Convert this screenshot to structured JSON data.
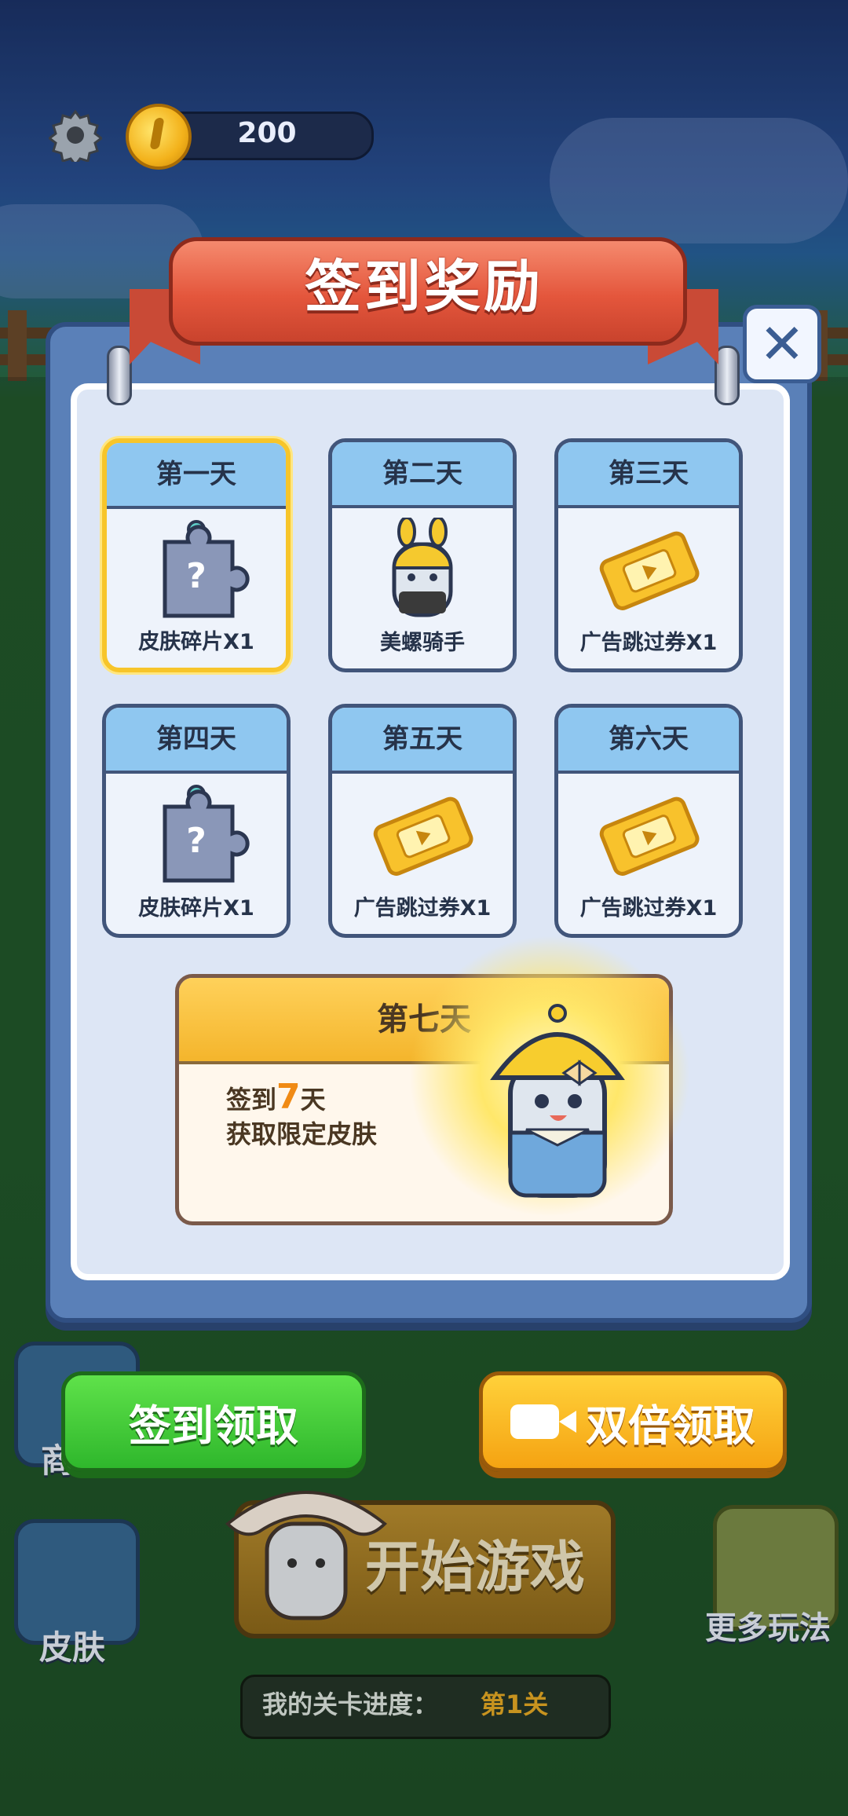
{
  "top_bar": {
    "coins": "200",
    "settings_icon": "gear-icon",
    "coin_icon": "coin-icon"
  },
  "dialog": {
    "title": "签到奖励",
    "close_icon": "close-icon",
    "days": [
      {
        "day": "第一天",
        "reward": "皮肤碎片X1",
        "icon": "puzzle-piece-icon",
        "selected": true
      },
      {
        "day": "第二天",
        "reward": "美螺骑手",
        "icon": "rider-skin-icon",
        "selected": false
      },
      {
        "day": "第三天",
        "reward": "广告跳过券X1",
        "icon": "ticket-icon",
        "selected": false
      },
      {
        "day": "第四天",
        "reward": "皮肤碎片X1",
        "icon": "puzzle-piece-icon",
        "selected": false
      },
      {
        "day": "第五天",
        "reward": "广告跳过券X1",
        "icon": "ticket-icon",
        "selected": false
      },
      {
        "day": "第六天",
        "reward": "广告跳过券X1",
        "icon": "ticket-icon",
        "selected": false
      }
    ],
    "day7": {
      "day": "第七天",
      "line1_prefix": "签到",
      "line1_number": "7",
      "line1_suffix": "天",
      "line2": "获取限定皮肤",
      "icon": "limited-skin-character-icon"
    }
  },
  "buttons": {
    "sign_in": "签到领取",
    "double": "双倍领取",
    "double_icon": "video-camera-icon"
  },
  "lobby": {
    "shop_label": "商",
    "skin_label": "皮肤",
    "start_game": "开始游戏",
    "more_play": "更多玩法",
    "progress_label": "我的关卡进度：",
    "progress_value": "第1关"
  },
  "colors": {
    "green_button": "#2fb72c",
    "orange_button": "#f5a312",
    "ribbon": "#e4563c",
    "selected_border": "#f7c52a"
  }
}
